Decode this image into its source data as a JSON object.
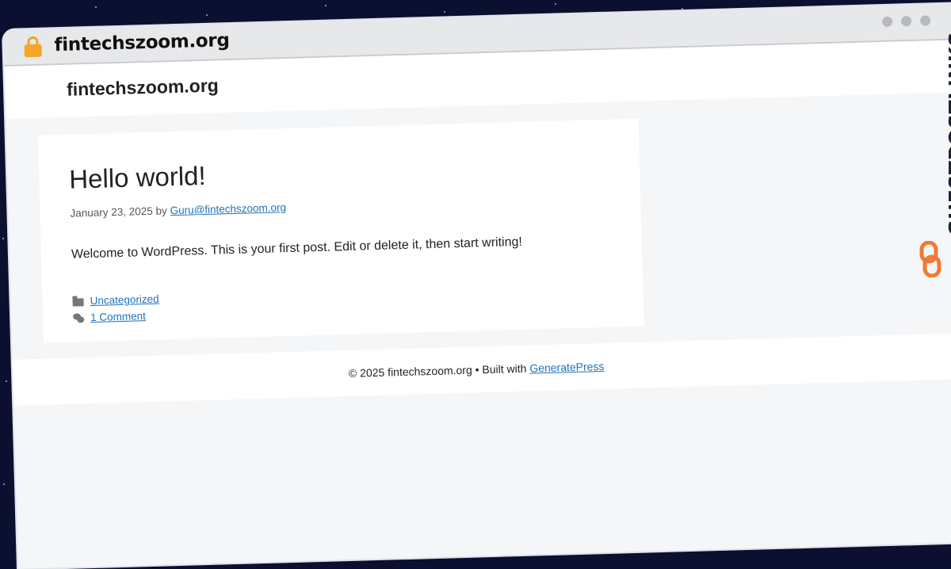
{
  "browser": {
    "url": "fintechszoom.org"
  },
  "site": {
    "title": "fintechszoom.org"
  },
  "post": {
    "title": "Hello world!",
    "date": "January 23, 2025",
    "by_label": "by",
    "author": "Guru@fintechszoom.org",
    "excerpt": "Welcome to WordPress. This is your first post. Edit or delete it, then start writing!",
    "category": "Uncategorized",
    "comments": "1 Comment"
  },
  "footer": {
    "copyright": "© 2025 fintechszoom.org • Built with",
    "theme_link": "GeneratePress"
  },
  "watermark": {
    "text": "GUESTPOSTLINKS"
  },
  "colors": {
    "link": "#1e72bd",
    "lock": "#f4a52a",
    "watermark_logo": "#f07a35"
  }
}
